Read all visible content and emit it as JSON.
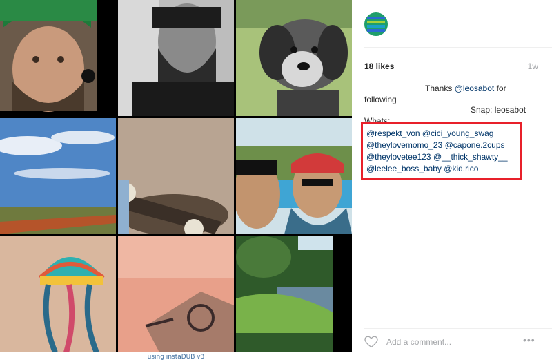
{
  "collage": {
    "watermark": "using instaDUB v3"
  },
  "post": {
    "likes": "18 likes",
    "age": "1w",
    "caption": {
      "thanks_text": "Thanks ",
      "thanks_mention": "@leosabot",
      "thanks_suffix": " for",
      "following": "following",
      "snap": "Snap: leosabot",
      "whats": "Whats:"
    },
    "mentions": [
      "@respekt_von",
      "@cici_young_swag",
      "@theylovemomo_23",
      "@capone.2cups",
      "@theylovetee123",
      "@__thick_shawty__",
      "@leelee_boss_baby",
      "@kid.rico"
    ]
  },
  "comment": {
    "placeholder": "Add a comment..."
  },
  "more": {
    "label": "•••"
  },
  "colors": {
    "highlight_border": "#e8202a",
    "link": "#003569"
  },
  "icons": [
    "avatar",
    "heart-icon",
    "more-options-icon"
  ]
}
